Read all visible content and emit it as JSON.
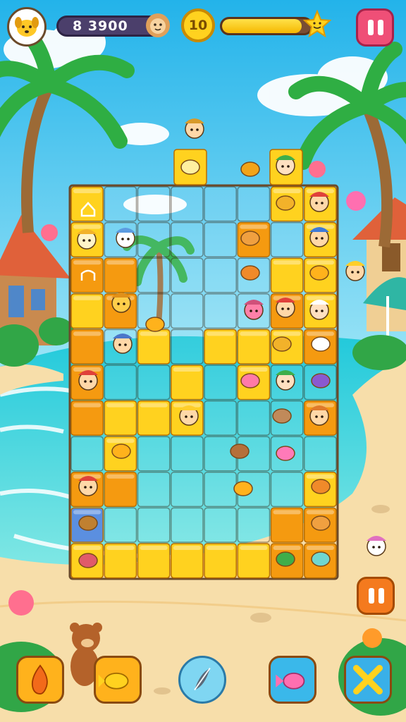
{
  "hud": {
    "score": "8 3900",
    "coins": "10",
    "level_progress": 0.9
  },
  "icons": {
    "avatar": "yellow-dog-face-icon",
    "score_face": "lion-face-icon",
    "star": "smiling-star-icon",
    "pause": "pause-icon"
  },
  "colors": {
    "sky": "#3cc2ee",
    "sea": "#2fd4d8",
    "sand": "#f7deaa",
    "board_frame": "#6b4a2a",
    "tile_yellow": "#ffd21f",
    "tile_orange": "#f59a10",
    "tile_blue": "#5b8fe0",
    "pause_top": "#ef4f77",
    "pause_side": "#f47a1e"
  },
  "board": {
    "cols": 8,
    "rows": 11
  },
  "actions": [
    {
      "name": "fire-powerup",
      "icon": "flame-icon",
      "color": "#ffb21c"
    },
    {
      "name": "fish-powerup",
      "icon": "fish-icon",
      "color": "#ffb21c"
    },
    {
      "name": "hint-powerup",
      "icon": "feather-icon",
      "color": "#7fd6f2"
    },
    {
      "name": "pink-fish-powerup",
      "icon": "pink-fish-icon",
      "color": "#3ab8ea"
    },
    {
      "name": "shuffle-powerup",
      "icon": "cross-arrows-icon",
      "color": "#39b0e8"
    }
  ]
}
